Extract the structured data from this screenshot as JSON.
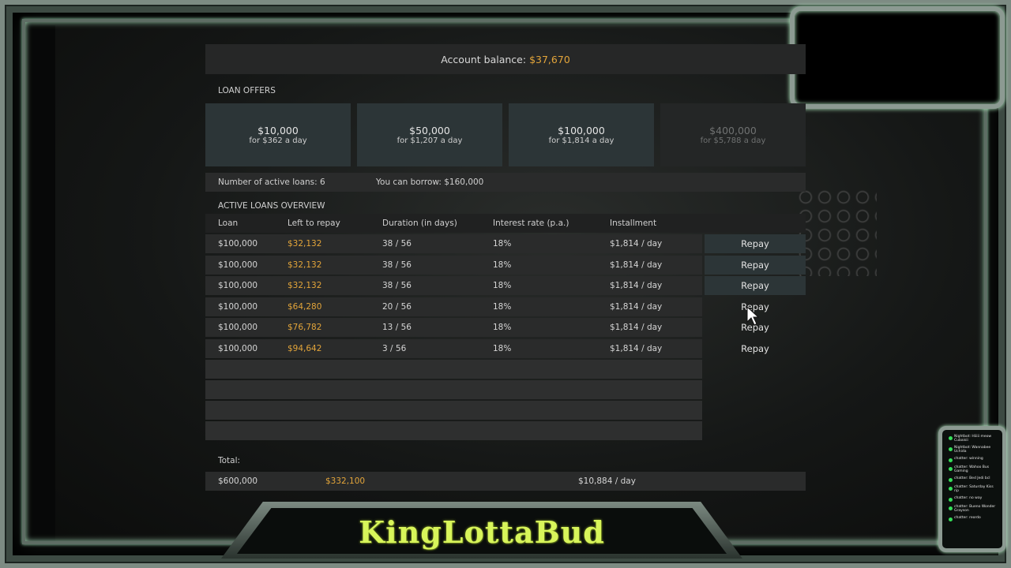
{
  "stream": {
    "streamer_name": "KingLottaBud",
    "chat_lines": [
      "Nightbot: Hiiiii meow Cubaisii",
      "Nightbot: Wannabee Uchida",
      "chatter: winning",
      "chatter: Wahoo Bus Gaming",
      "chatter: Bed Jedi bcl",
      "chatter: Saturday Kiss rip",
      "chatter: no way",
      "chatter: Bueno Wonder Grayson",
      "chatter: reordo"
    ]
  },
  "loan_ui": {
    "balance_label": "Account balance:",
    "balance_value": "$37,670",
    "offers_title": "LOAN OFFERS",
    "offers": [
      {
        "amount": "$10,000",
        "rate": "for $362 a day",
        "enabled": true
      },
      {
        "amount": "$50,000",
        "rate": "for $1,207 a day",
        "enabled": true
      },
      {
        "amount": "$100,000",
        "rate": "for $1,814 a day",
        "enabled": true
      },
      {
        "amount": "$400,000",
        "rate": "for $5,788 a day",
        "enabled": false
      }
    ],
    "active_loans_count": "Number of active loans: 6",
    "can_borrow": "You can borrow: $160,000",
    "overview_title": "ACTIVE LOANS OVERVIEW",
    "columns": [
      "Loan",
      "Left to repay",
      "Duration (in days)",
      "Interest rate (p.a.)",
      "Installment"
    ],
    "rows": [
      {
        "loan": "$100,000",
        "left": "$32,132",
        "duration": "38 / 56",
        "rate": "18%",
        "installment": "$1,814 / day",
        "action": "Repay"
      },
      {
        "loan": "$100,000",
        "left": "$32,132",
        "duration": "38 / 56",
        "rate": "18%",
        "installment": "$1,814 / day",
        "action": "Repay"
      },
      {
        "loan": "$100,000",
        "left": "$32,132",
        "duration": "38 / 56",
        "rate": "18%",
        "installment": "$1,814 / day",
        "action": "Repay"
      },
      {
        "loan": "$100,000",
        "left": "$64,280",
        "duration": "20 / 56",
        "rate": "18%",
        "installment": "$1,814 / day",
        "action": "Repay"
      },
      {
        "loan": "$100,000",
        "left": "$76,782",
        "duration": "13 / 56",
        "rate": "18%",
        "installment": "$1,814 / day",
        "action": "Repay"
      },
      {
        "loan": "$100,000",
        "left": "$94,642",
        "duration": "3 / 56",
        "rate": "18%",
        "installment": "$1,814 / day",
        "action": "Repay"
      }
    ],
    "total_label": "Total:",
    "total": {
      "loan": "$600,000",
      "left": "$332,100",
      "installment": "$10,884 / day"
    }
  },
  "colors": {
    "accent_gold": "#e3a53a",
    "button_bg": "#2c3537",
    "name_green": "#d8f55a"
  },
  "icons": {
    "cursor": "mouse-pointer-icon"
  }
}
